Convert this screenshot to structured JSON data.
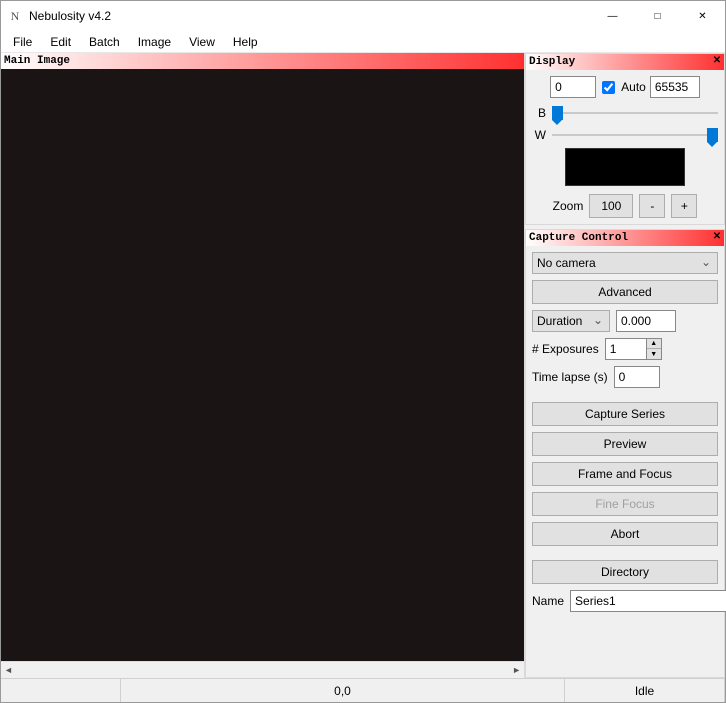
{
  "window": {
    "title": "Nebulosity v4.2"
  },
  "menu": [
    "File",
    "Edit",
    "Batch",
    "Image",
    "View",
    "Help"
  ],
  "main_panel": {
    "title": "Main Image"
  },
  "display": {
    "title": "Display",
    "min_value": "0",
    "max_value": "65535",
    "auto_label": "Auto",
    "black_label": "B",
    "white_label": "W",
    "zoom_label": "Zoom",
    "zoom_value": "100",
    "zoom_minus": "-",
    "zoom_plus": "+"
  },
  "capture": {
    "title": "Capture Control",
    "camera_selected": "No camera",
    "advanced_btn": "Advanced",
    "duration_label": "Duration",
    "duration_value": "0.000",
    "exposures_label": "# Exposures",
    "exposures_value": "1",
    "timelapse_label": "Time lapse (s)",
    "timelapse_value": "0",
    "capture_series_btn": "Capture Series",
    "preview_btn": "Preview",
    "frame_focus_btn": "Frame and Focus",
    "fine_focus_btn": "Fine Focus",
    "abort_btn": "Abort",
    "directory_btn": "Directory",
    "name_label": "Name",
    "name_value": "Series1"
  },
  "status": {
    "coords": "0,0",
    "state": "Idle"
  }
}
